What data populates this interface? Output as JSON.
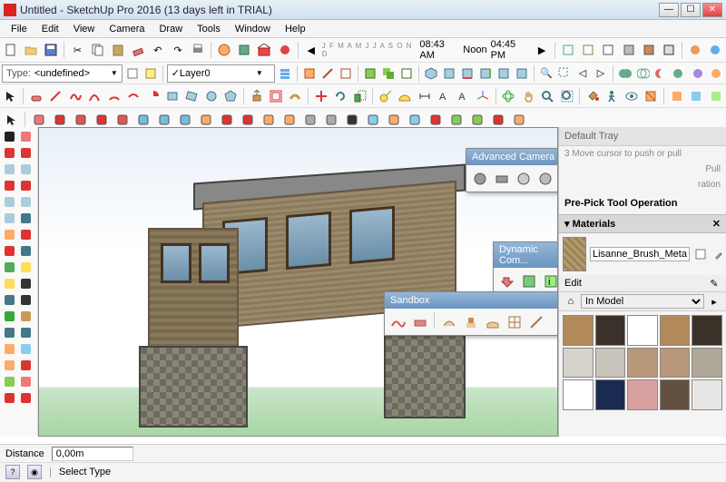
{
  "title": "Untitled - SketchUp Pro 2016 (13 days left in TRIAL)",
  "menus": [
    "File",
    "Edit",
    "View",
    "Camera",
    "Draw",
    "Tools",
    "Window",
    "Help"
  ],
  "type_label": "Type:",
  "type_value": "<undefined>",
  "layer_value": "Layer0",
  "time_labels": {
    "left": "08:43 AM",
    "mid": "Noon",
    "right": "04:45 PM",
    "months": "J F M A M J J A S O N D"
  },
  "tray": {
    "title": "Default Tray",
    "hint_line1": "3  Move cursor to push or pull",
    "hint_line2": "Pull",
    "hint_line3": "ration",
    "op_title": "Pre-Pick Tool Operation",
    "materials_hdr": "Materials",
    "material_name": "Lisanne_Brush_Metal",
    "edit_label": "Edit",
    "scope_label": "In Model"
  },
  "swatches": [
    "#b28a5a",
    "#3a322a",
    "#ffffff",
    "#b28a5a",
    "#3a3228",
    "#d6d2cc",
    "#c8c4bc",
    "#b89878",
    "#b89878",
    "#b0a898",
    "#ffffff",
    "#1a2a50",
    "#d8a0a0",
    "#625040",
    "#e8e6e4"
  ],
  "float_panels": {
    "camera": "Advanced Camera Tools",
    "dynamic": "Dynamic Com...",
    "sandbox": "Sandbox"
  },
  "status": {
    "distance_label": "Distance",
    "distance_value": "0,00m",
    "select_type": "Select Type"
  }
}
